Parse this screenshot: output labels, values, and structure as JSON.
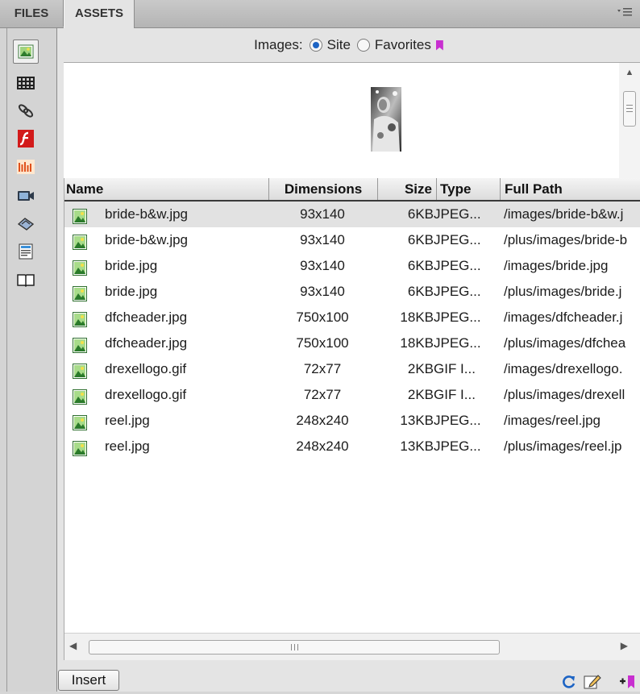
{
  "tabs": {
    "files": "FILES",
    "assets": "ASSETS"
  },
  "panel_menu_icon": "panel-menu-icon",
  "categories": [
    {
      "name": "images-icon",
      "selected": true
    },
    {
      "name": "colors-icon"
    },
    {
      "name": "urls-icon"
    },
    {
      "name": "swf-icon"
    },
    {
      "name": "shockwave-icon"
    },
    {
      "name": "movies-icon"
    },
    {
      "name": "scripts-icon"
    },
    {
      "name": "templates-icon"
    },
    {
      "name": "library-icon"
    }
  ],
  "filter": {
    "label": "Images:",
    "options": [
      {
        "label": "Site",
        "checked": true
      },
      {
        "label": "Favorites",
        "checked": false
      }
    ]
  },
  "columns": {
    "name": "Name",
    "dimensions": "Dimensions",
    "size": "Size",
    "type": "Type",
    "full_path": "Full Path"
  },
  "rows": [
    {
      "name": "bride-b&w.jpg",
      "dimensions": "93x140",
      "size": "6KB",
      "type": "JPEG...",
      "path": "/images/bride-b&w.j",
      "selected": true
    },
    {
      "name": "bride-b&w.jpg",
      "dimensions": "93x140",
      "size": "6KB",
      "type": "JPEG...",
      "path": "/plus/images/bride-b"
    },
    {
      "name": "bride.jpg",
      "dimensions": "93x140",
      "size": "6KB",
      "type": "JPEG...",
      "path": "/images/bride.jpg"
    },
    {
      "name": "bride.jpg",
      "dimensions": "93x140",
      "size": "6KB",
      "type": "JPEG...",
      "path": "/plus/images/bride.j"
    },
    {
      "name": "dfcheader.jpg",
      "dimensions": "750x100",
      "size": "18KB",
      "type": "JPEG...",
      "path": "/images/dfcheader.j"
    },
    {
      "name": "dfcheader.jpg",
      "dimensions": "750x100",
      "size": "18KB",
      "type": "JPEG...",
      "path": "/plus/images/dfchea"
    },
    {
      "name": "drexellogo.gif",
      "dimensions": "72x77",
      "size": "2KB",
      "type": "GIF I...",
      "path": "/images/drexellogo."
    },
    {
      "name": "drexellogo.gif",
      "dimensions": "72x77",
      "size": "2KB",
      "type": "GIF I...",
      "path": "/plus/images/drexell"
    },
    {
      "name": "reel.jpg",
      "dimensions": "248x240",
      "size": "13KB",
      "type": "JPEG...",
      "path": "/images/reel.jpg"
    },
    {
      "name": "reel.jpg",
      "dimensions": "248x240",
      "size": "13KB",
      "type": "JPEG...",
      "path": "/plus/images/reel.jp"
    }
  ],
  "footer": {
    "insert_label": "Insert",
    "tools": [
      "refresh-icon",
      "edit-icon",
      "add-to-favorites-icon"
    ]
  },
  "colors": {
    "accent": "#1d64c4",
    "favorites": "#c82fd0",
    "refresh": "#1d64c4"
  }
}
